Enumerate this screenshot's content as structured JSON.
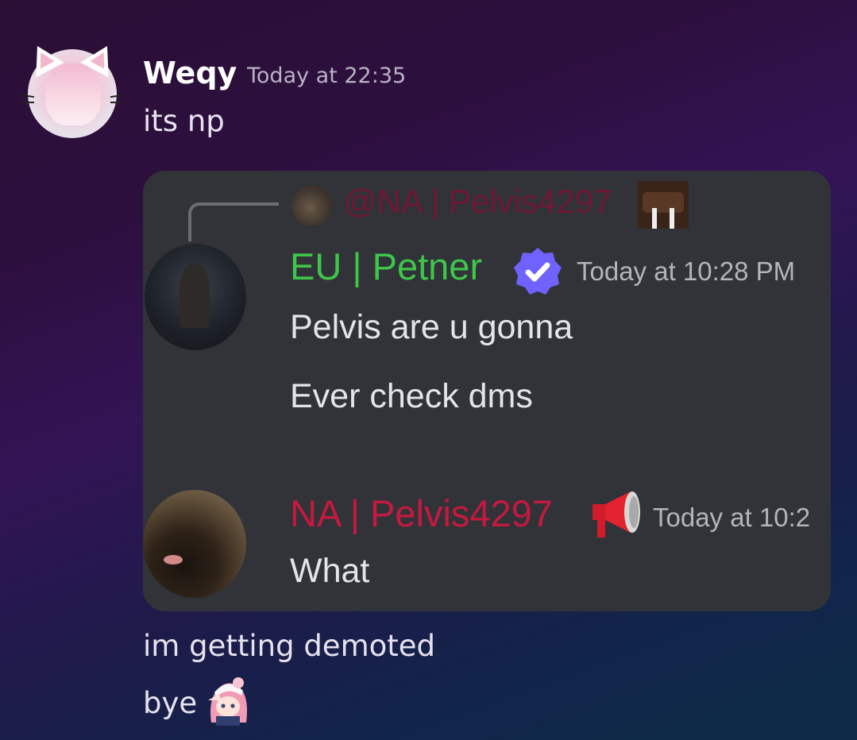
{
  "message": {
    "author": "Weqy",
    "timestamp": "Today at 22:35",
    "lines": [
      "its np",
      "im getting demoted",
      "bye"
    ]
  },
  "embed": {
    "reply": {
      "mention": "@NA | Pelvis4297",
      "walrus_icon": "walrus-emoji-icon"
    },
    "messages": [
      {
        "author": "EU | Petner",
        "author_color": "#3ec64a",
        "badge": "verified-badge-icon",
        "timestamp": "Today at 10:28 PM",
        "lines": [
          "Pelvis are u gonna",
          "Ever check dms"
        ]
      },
      {
        "author": "NA | Pelvis4297",
        "author_color": "#c5193f",
        "badge": "megaphone-icon",
        "timestamp": "Today at 10:2",
        "lines": [
          "What"
        ]
      }
    ]
  },
  "colors": {
    "background_start": "#2a0f35",
    "background_end": "#0d2a46",
    "embed_bg": "#313338"
  }
}
